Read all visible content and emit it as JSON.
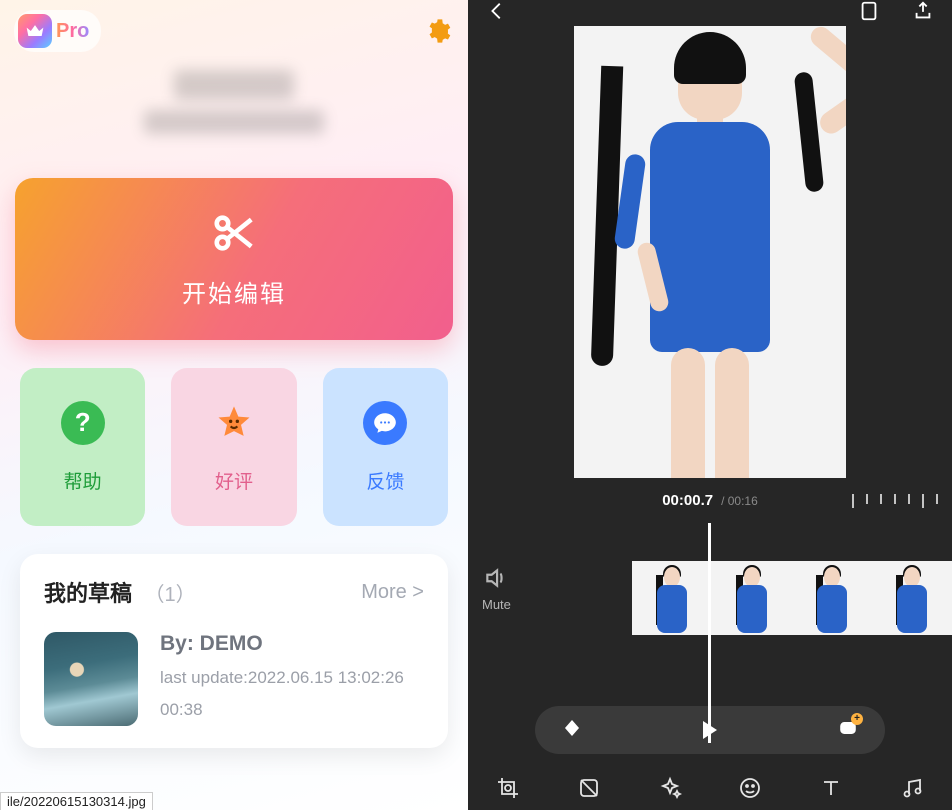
{
  "left": {
    "pro_label": "Pro",
    "start_edit_label": "开始编辑",
    "actions": {
      "help": "帮助",
      "rate": "好评",
      "feedback": "反馈"
    },
    "drafts": {
      "title": "我的草稿",
      "count": "（1）",
      "more": "More >",
      "item": {
        "by": "By: DEMO",
        "updated": "last update:2022.06.15 13:02:26",
        "duration": "00:38"
      }
    },
    "status_path": "ile/20220615130314.jpg"
  },
  "right": {
    "time_current": "00:00.7",
    "time_total": "/ 00:16",
    "mute_label": "Mute"
  }
}
